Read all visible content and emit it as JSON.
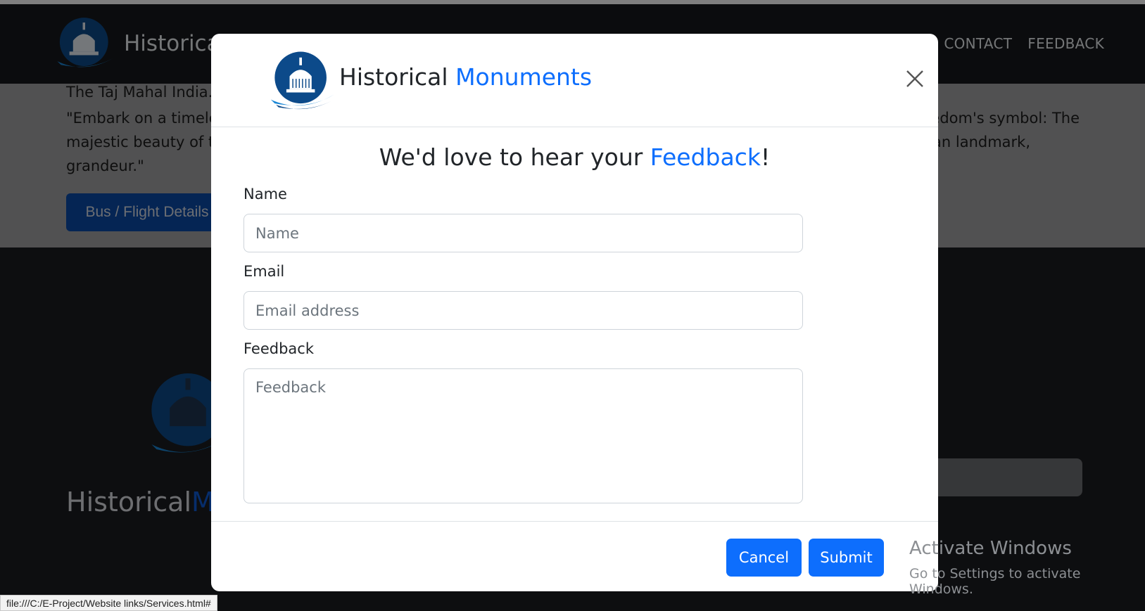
{
  "navbar": {
    "brand": "Historical",
    "links": [
      "CONTACT",
      "FEEDBACK"
    ]
  },
  "hero": {
    "caption": "The Taj Mahal India.",
    "quote_left_1": "\"Embark on a timele",
    "quote_right_1": "edom's symbol: The",
    "quote_left_2": "majestic beauty of t",
    "quote_right_2": "ranian landmark,",
    "quote_left_3": "grandeur.\"",
    "button_label": "Bus / Flight Details"
  },
  "footer": {
    "brand_main": "Historical",
    "brand_accent": "M"
  },
  "modal": {
    "brand_main": "Historical ",
    "brand_accent": "Monuments",
    "title_prefix": "We'd love to hear your ",
    "title_accent": "Feedback",
    "title_suffix": "!",
    "fields": {
      "name_label": "Name",
      "name_placeholder": "Name",
      "email_label": "Email",
      "email_placeholder": "Email address",
      "feedback_label": "Feedback",
      "feedback_placeholder": "Feedback"
    },
    "cancel_label": "Cancel",
    "submit_label": "Submit"
  },
  "os": {
    "activate_title": "Activate Windows",
    "activate_sub": "Go to Settings to activate Windows.",
    "status_url": "file:///C:/E-Project/Website links/Services.html#"
  },
  "colors": {
    "accent": "#0d6efd",
    "navbar_bg": "#17191c",
    "hero_bg": "#a2a3a5"
  },
  "icons": {
    "logo": "capitol-dome-logo-icon",
    "close": "close-icon"
  }
}
